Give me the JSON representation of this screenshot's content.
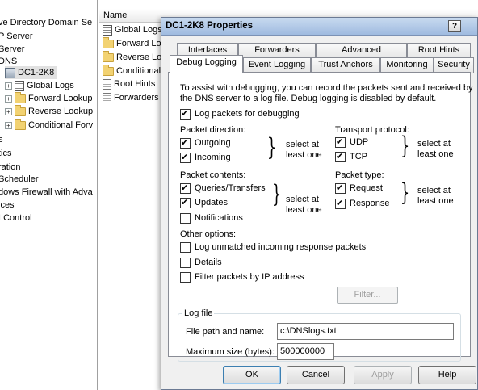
{
  "tree": {
    "items": [
      {
        "label": "ve Directory Domain Se"
      },
      {
        "label": "P Server"
      },
      {
        "label": "Server"
      },
      {
        "label": "DNS"
      },
      {
        "label": "DC1-2K8"
      },
      {
        "label": "Global Logs"
      },
      {
        "label": "Forward Lookup"
      },
      {
        "label": "Reverse Lookup"
      },
      {
        "label": "Conditional Forv"
      },
      {
        "label": "s"
      },
      {
        "label": "tics"
      },
      {
        "label": "ration"
      },
      {
        "label": "Scheduler"
      },
      {
        "label": "dows Firewall with Adva"
      },
      {
        "label": "ices"
      },
      {
        "label": "I Control"
      }
    ]
  },
  "list": {
    "header_name": "Name",
    "items": [
      {
        "label": "Global Logs"
      },
      {
        "label": "Forward Lo"
      },
      {
        "label": "Reverse Lo"
      },
      {
        "label": "Conditional"
      },
      {
        "label": "Root Hints"
      },
      {
        "label": "Forwarders"
      }
    ]
  },
  "dialog": {
    "title": "DC1-2K8 Properties",
    "help_label": "?",
    "tabs_row1": [
      "Interfaces",
      "Forwarders",
      "Advanced",
      "Root Hints"
    ],
    "tabs_row2": [
      "Debug Logging",
      "Event Logging",
      "Trust Anchors",
      "Monitoring",
      "Security"
    ],
    "intro": [
      "To assist with debugging, you can record the packets sent and received by",
      "the DNS server to a log file. Debug logging is disabled by default."
    ],
    "log_packets": {
      "label": "Log packets for debugging",
      "checked": true
    },
    "packet_direction": {
      "title": "Packet direction:",
      "outgoing": {
        "label": "Outgoing",
        "checked": true
      },
      "incoming": {
        "label": "Incoming",
        "checked": true
      },
      "note": [
        "select at",
        "least one"
      ]
    },
    "transport_protocol": {
      "title": "Transport protocol:",
      "udp": {
        "label": "UDP",
        "checked": true
      },
      "tcp": {
        "label": "TCP",
        "checked": true
      },
      "note": [
        "select at",
        "least one"
      ]
    },
    "packet_contents": {
      "title": "Packet contents:",
      "queries": {
        "label": "Queries/Transfers",
        "checked": true
      },
      "updates": {
        "label": "Updates",
        "checked": true
      },
      "notifications": {
        "label": "Notifications",
        "checked": false
      },
      "note": [
        "select at",
        "least one"
      ]
    },
    "packet_type": {
      "title": "Packet type:",
      "request": {
        "label": "Request",
        "checked": true
      },
      "response": {
        "label": "Response",
        "checked": true
      },
      "note": [
        "select at",
        "least one"
      ]
    },
    "other_options": {
      "title": "Other options:",
      "log_unmatched": {
        "label": "Log unmatched incoming response packets",
        "checked": false
      },
      "details": {
        "label": "Details",
        "checked": false
      },
      "filter": {
        "label": "Filter packets by IP address",
        "checked": false
      },
      "filter_button": "Filter..."
    },
    "log_file": {
      "title": "Log file",
      "path_label": "File path and name:",
      "path_value": "c:\\DNSlogs.txt",
      "size_label": "Maximum size (bytes):",
      "size_value": "500000000"
    },
    "buttons": {
      "ok": "OK",
      "cancel": "Cancel",
      "apply": "Apply",
      "help": "Help"
    }
  }
}
